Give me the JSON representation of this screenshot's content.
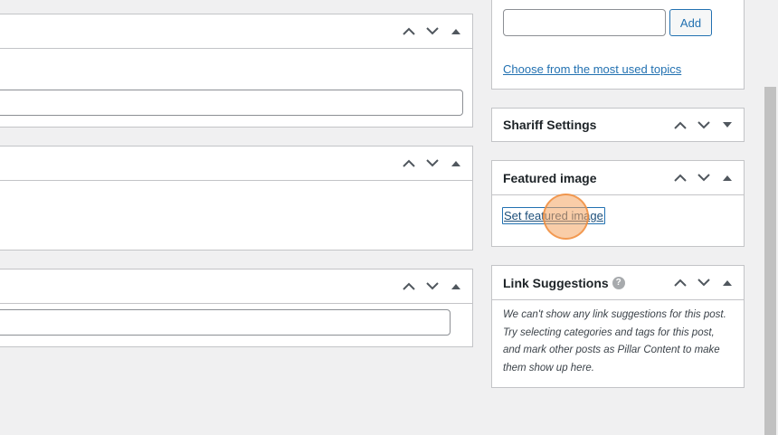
{
  "topics": {
    "add_button": "Add",
    "most_used_link": "Choose from the most used topics",
    "input_value": ""
  },
  "shariff": {
    "title": "Shariff Settings"
  },
  "featured_image": {
    "title": "Featured image",
    "link": "Set featured image"
  },
  "link_suggestions": {
    "title": "Link Suggestions",
    "help": "?",
    "note": "We can't show any link suggestions for this post. Try selecting categories and tags for this post, and mark other posts as Pillar Content to make them show up here."
  },
  "left_panels": {
    "panel1_input": "",
    "panel3_input": ""
  },
  "colors": {
    "accent": "#2271b1",
    "click_indicator": "#f4a460"
  },
  "icons": [
    "chevron-up-icon",
    "chevron-down-icon",
    "toggle-arrow-icon",
    "help-icon"
  ]
}
